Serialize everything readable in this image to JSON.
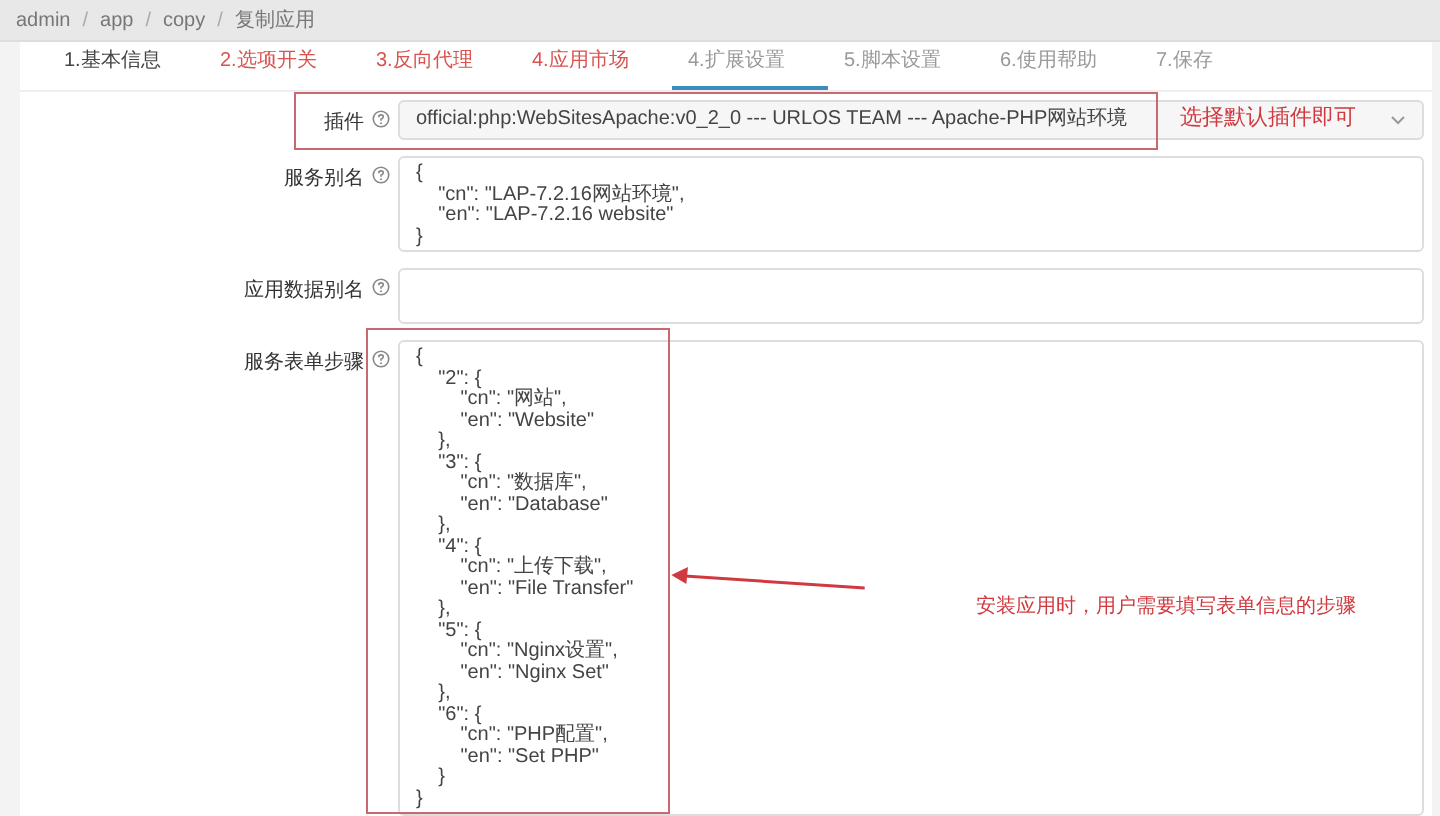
{
  "breadcrumb": [
    "admin",
    "/",
    "app",
    "/",
    "copy",
    "/",
    "复制应用"
  ],
  "tabs": [
    {
      "label": "1.基本信息",
      "kind": "normal",
      "selected": false
    },
    {
      "label": "2.选项开关",
      "kind": "error",
      "selected": false
    },
    {
      "label": "3.反向代理",
      "kind": "error",
      "selected": false
    },
    {
      "label": "4.应用市场",
      "kind": "error",
      "selected": false
    },
    {
      "label": "4.扩展设置",
      "kind": "pending",
      "selected": true
    },
    {
      "label": "5.脚本设置",
      "kind": "pending",
      "selected": false
    },
    {
      "label": "6.使用帮助",
      "kind": "pending",
      "selected": false
    },
    {
      "label": "7.保存",
      "kind": "pending",
      "selected": false
    }
  ],
  "form": [
    {
      "label": "插件",
      "kind": "select",
      "value": "official:php:WebSitesApache:v0_2_0 --- URLOS TEAM --- Apache-PHP网站环境"
    },
    {
      "label": "服务别名",
      "kind": "textarea",
      "value": "{\n    \"cn\": \"LAP-7.2.16网站环境\",\n    \"en\": \"LAP-7.2.16 website\"\n}"
    },
    {
      "label": "应用数据别名",
      "kind": "textarea"
    },
    {
      "label": "服务表单步骤",
      "kind": "textarea",
      "value": "{\n    \"2\": {\n        \"cn\": \"网站\",\n        \"en\": \"Website\"\n    },\n    \"3\": {\n        \"cn\": \"数据库\",\n        \"en\": \"Database\"\n    },\n    \"4\": {\n        \"cn\": \"上传下载\",\n        \"en\": \"File Transfer\"\n    },\n    \"5\": {\n        \"cn\": \"Nginx设置\",\n        \"en\": \"Nginx Set\"\n    },\n    \"6\": {\n        \"cn\": \"PHP配置\",\n        \"en\": \"Set PHP\"\n    }\n}"
    }
  ],
  "annotations": [
    "选择默认插件即可",
    "安装应用时，用户需要填写表单信息的步骤"
  ]
}
